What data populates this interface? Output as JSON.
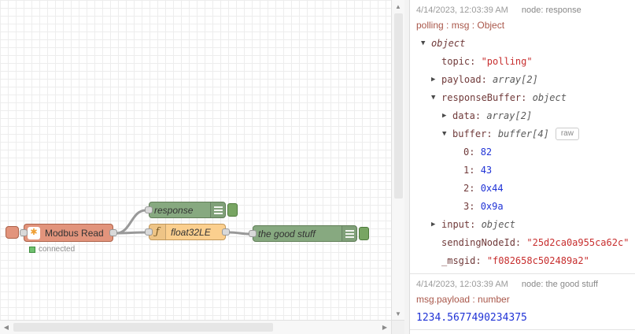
{
  "colors": {
    "debug_node": "#87a980",
    "function_node": "#fbcf8e",
    "modbus_node": "#e2947c",
    "status_connected": "#6fc06f",
    "string_value": "#c72e2e",
    "number_value": "#2033d6",
    "key_text": "#703a3a",
    "path_text": "#a9574a"
  },
  "canvas": {
    "modbus": {
      "label": "Modbus Read",
      "icon": "✱",
      "status": "connected"
    },
    "response_node": {
      "label": "response"
    },
    "function_node": {
      "label": "float32LE",
      "icon": "ƒ"
    },
    "good_stuff_node": {
      "label": "the good stuff"
    }
  },
  "scrollbars": {
    "up": "▲",
    "down": "▼",
    "left": "◀",
    "right": "▶"
  },
  "sidebar": {
    "messages": [
      {
        "timestamp": "4/14/2023, 12:03:39 AM",
        "node": "node: response",
        "path": "polling : msg : Object",
        "tree": [
          {
            "arrow": "▼",
            "label": "object"
          },
          {
            "key": "topic",
            "value": "\"polling\""
          },
          {
            "arrow": "▶",
            "key": "payload",
            "value": "array[2]"
          },
          {
            "arrow": "▼",
            "key": "responseBuffer",
            "value": "object"
          },
          {
            "arrow": "▶",
            "key": "data",
            "value": "array[2]"
          },
          {
            "arrow": "▼",
            "key": "buffer",
            "value": "buffer[4]",
            "raw": "raw"
          },
          {
            "key": "0",
            "value": "82"
          },
          {
            "key": "1",
            "value": "43"
          },
          {
            "key": "2",
            "value": "0x44"
          },
          {
            "key": "3",
            "value": "0x9a"
          },
          {
            "arrow": "▶",
            "key": "input",
            "value": "object"
          },
          {
            "key": "sendingNodeId",
            "value": "\"25d2ca0a955ca62c\""
          },
          {
            "key": "_msgid",
            "value": "\"f082658c502489a2\""
          }
        ]
      },
      {
        "timestamp": "4/14/2023, 12:03:39 AM",
        "node": "node: the good stuff",
        "path": "msg.payload : number",
        "value": "1234.5677490234375"
      }
    ]
  }
}
